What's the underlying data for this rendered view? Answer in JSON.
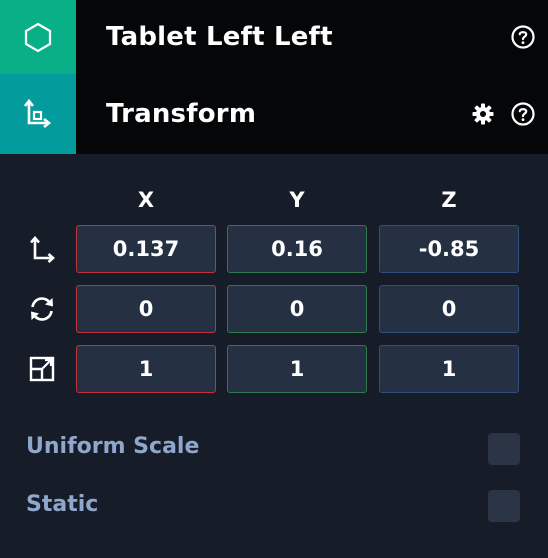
{
  "entity": {
    "title": "Tablet Left Left",
    "icon": "hexagon-icon"
  },
  "transform": {
    "title": "Transform",
    "icon": "transform-axes-icon"
  },
  "axes": [
    "X",
    "Y",
    "Z"
  ],
  "rows": {
    "position": {
      "icon": "position-axes-icon",
      "x": "0.137",
      "y": "0.16",
      "z": "-0.85"
    },
    "rotation": {
      "icon": "rotation-icon",
      "x": "0",
      "y": "0",
      "z": "0"
    },
    "scale": {
      "icon": "scale-icon",
      "x": "1",
      "y": "1",
      "z": "1"
    }
  },
  "props": {
    "uniform_scale": {
      "label": "Uniform Scale",
      "checked": false
    },
    "static": {
      "label": "Static",
      "checked": false
    }
  },
  "colors": {
    "entity_tile": "#09b087",
    "transform_tile": "#049b9c",
    "x_border": "#c0313c",
    "y_border": "#2e7a4f",
    "z_border": "#2c4f7e"
  }
}
